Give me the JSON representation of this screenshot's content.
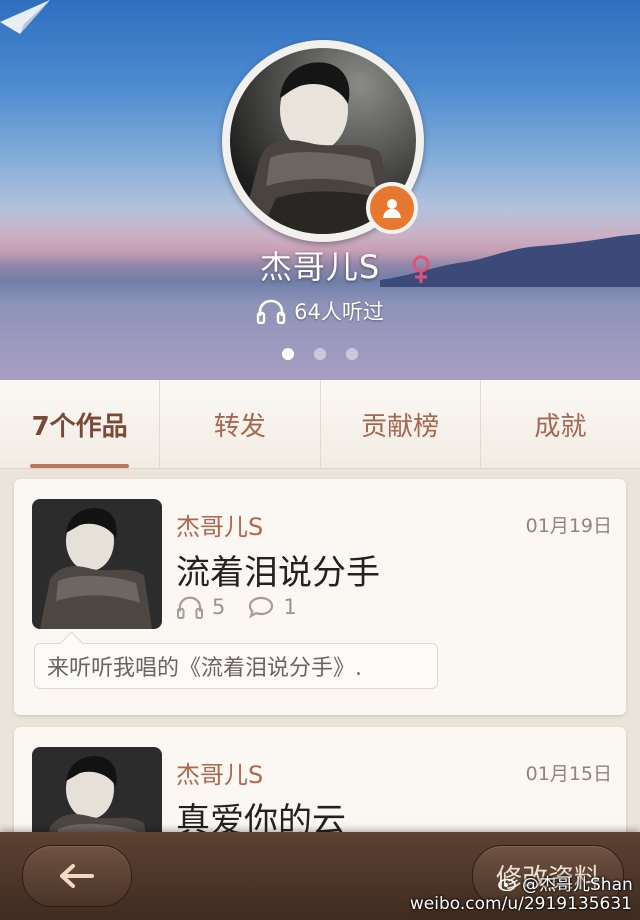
{
  "profile": {
    "name": "杰哥儿S",
    "listen_count_text": "64人听过"
  },
  "tabs": [
    {
      "label": "7个作品",
      "active": true
    },
    {
      "label": "转发",
      "active": false
    },
    {
      "label": "贡献榜",
      "active": false
    },
    {
      "label": "成就",
      "active": false
    }
  ],
  "feed": [
    {
      "author": "杰哥儿S",
      "date": "01月19日",
      "title": "流着泪说分手",
      "listens": "5",
      "comments": "1",
      "comment_text": "来听听我唱的《流着泪说分手》."
    },
    {
      "author": "杰哥儿S",
      "date": "01月15日",
      "title": "真爱你的云"
    }
  ],
  "bottom_bar": {
    "edit_label": "修改资料"
  },
  "watermark": {
    "handle": "@杰哥儿Shan",
    "url": "weibo.com/u/2919135631"
  },
  "colors": {
    "accent": "#b0664c",
    "badge": "#e8772f",
    "gender": "#e0527a",
    "bar": "#4a3427"
  },
  "pager": {
    "count": 3,
    "active_index": 0
  }
}
